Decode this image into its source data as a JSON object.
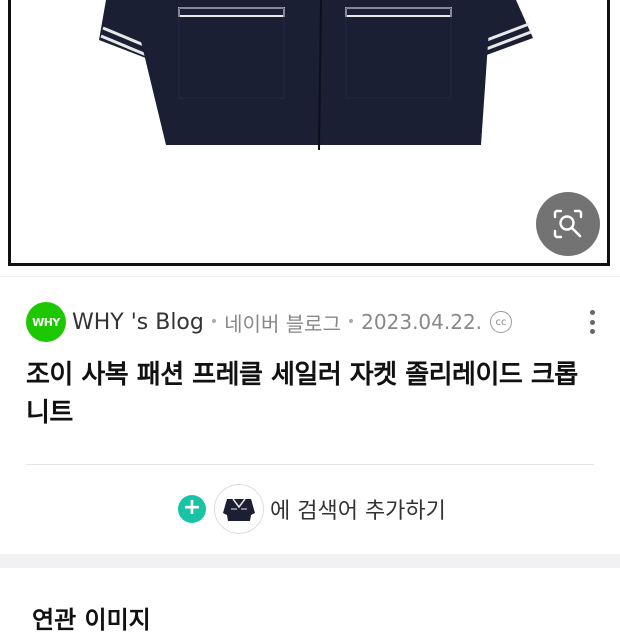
{
  "image_result": {
    "lens_button_label": "이미지 검색"
  },
  "source": {
    "logo_text": "WHY",
    "blog_name": "WHY 's Blog",
    "platform": "네이버 블로그",
    "date": "2023.04.22.",
    "license_badge": "cc"
  },
  "title": "조이 사복 패션 프레클 세일러 자켓 졸리레이드 크롭 니트",
  "add_search": {
    "plus_symbol": "+",
    "label": "에 검색어 추가하기"
  },
  "related": {
    "heading": "연관 이미지"
  },
  "colors": {
    "naver_green": "#1ec800",
    "add_button": "#19c3a5",
    "navy": "#1a1f33"
  },
  "icons": [
    "image-search-lens-icon",
    "more-vertical-icon",
    "cc-license-icon",
    "plus-icon"
  ]
}
